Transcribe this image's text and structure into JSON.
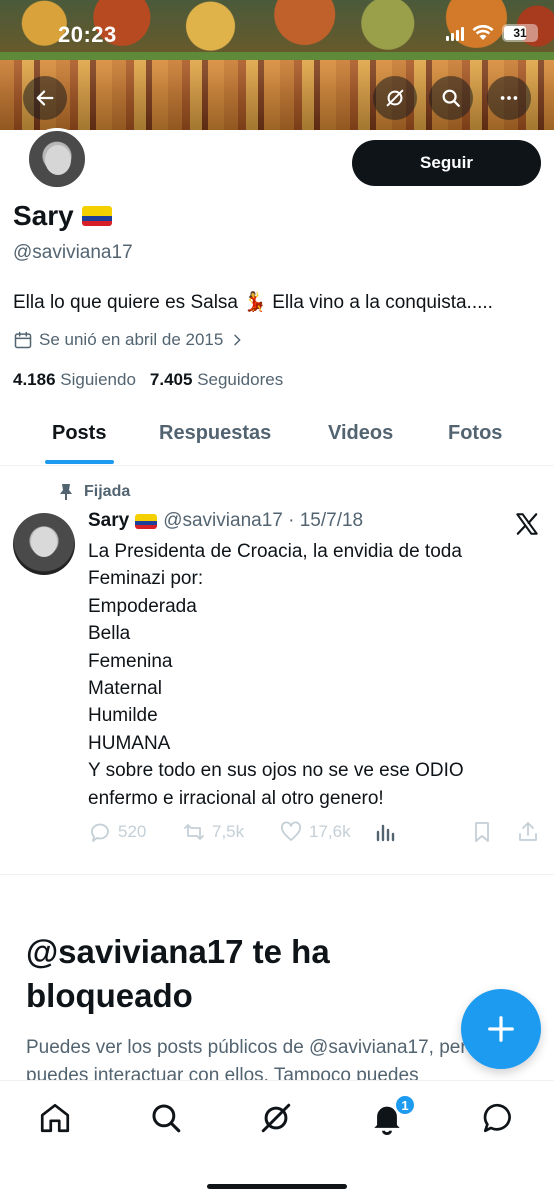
{
  "status_bar": {
    "time": "20:23",
    "battery": "31"
  },
  "header": {
    "back_icon": "arrow-left-icon",
    "grok_icon": "grok-icon",
    "search_icon": "search-icon",
    "more_icon": "more-icon"
  },
  "profile": {
    "name": "Sary",
    "flag_icon": "ecuador-flag-icon",
    "handle": "@saviviana17",
    "follow_label": "Seguir",
    "bio_before": "Ella lo que quiere es Salsa",
    "bio_emoji": "💃",
    "bio_after": "Ella vino a la conquista.....",
    "joined": "Se unió en abril de 2015",
    "following_count": "4.186",
    "following_label": "Siguiendo",
    "followers_count": "7.405",
    "followers_label": "Seguidores"
  },
  "tabs": [
    {
      "label": "Posts",
      "active": true
    },
    {
      "label": "Respuestas",
      "active": false
    },
    {
      "label": "Videos",
      "active": false
    },
    {
      "label": "Fotos",
      "active": false
    }
  ],
  "post": {
    "pinned_label": "Fijada",
    "author": "Sary",
    "handle_date": "@saviviana17 · 15/7/18",
    "lines": [
      "La Presidenta de Croacia, la envidia de toda",
      "Feminazi por:",
      "Empoderada",
      "Bella",
      "Femenina",
      "Maternal",
      "Humilde",
      "HUMANA",
      "Y sobre todo en sus ojos no se ve ese ODIO",
      "enfermo e irracional al otro genero!"
    ],
    "replies": "520",
    "reposts": "7,5k",
    "likes": "17,6k"
  },
  "blocked": {
    "title": "@saviviana17 te ha bloqueado",
    "description": "Puedes ver los posts públicos de @saviviana17, pero no puedes interactuar con ellos. Tampoco puedes"
  },
  "bottom_nav": {
    "notification_count": "1"
  },
  "colors": {
    "accent": "#1d9bf0",
    "text": "#0f1419",
    "muted": "#536471"
  }
}
